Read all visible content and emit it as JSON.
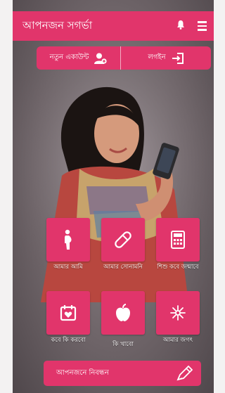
{
  "app": {
    "title": "আপনজন সগর্ভা"
  },
  "header": {
    "bell_icon": "bell-icon",
    "menu_icon": "hamburger-menu-icon"
  },
  "auth": {
    "new_account_label": "নতুন একাউন্ট",
    "login_label": "লগইন"
  },
  "tiles": [
    {
      "label": "আমার আমি",
      "icon": "pregnant-woman-icon"
    },
    {
      "label": "আমার সোনামনি",
      "icon": "pill-icon"
    },
    {
      "label": "শিশু কবে জন্মাবে",
      "icon": "calculator-icon"
    },
    {
      "label": "কবে কি করবো",
      "icon": "calendar-heart-icon"
    },
    {
      "label": "কি খাবো",
      "icon": "apple-icon"
    },
    {
      "label": "আমার জগৎ",
      "icon": "sparkle-icon"
    }
  ],
  "register": {
    "label": "আপনজনে নিবন্ধন",
    "icon": "pen-icon"
  },
  "colors": {
    "accent": "#e1356b"
  }
}
